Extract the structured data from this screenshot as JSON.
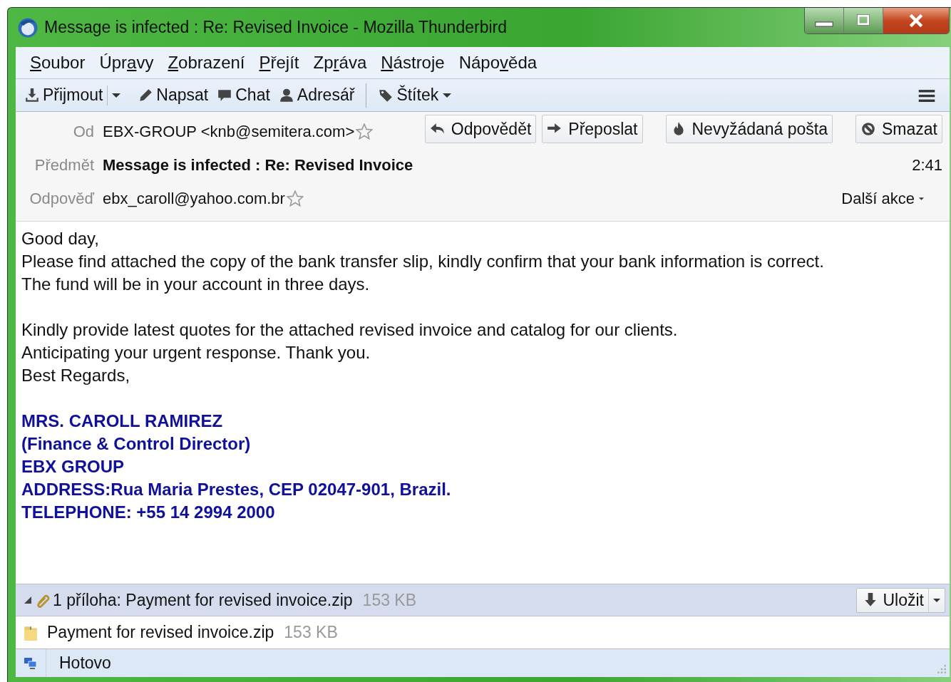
{
  "window": {
    "title": "Message is infected : Re: Revised Invoice - Mozilla Thunderbird"
  },
  "menu": [
    {
      "key": "S",
      "after": "oubor"
    },
    {
      "before": "Úpr",
      "key": "a",
      "after": "vy"
    },
    {
      "key": "Z",
      "after": "obrazení"
    },
    {
      "key": "P",
      "after": "řejít"
    },
    {
      "before": "Zp",
      "key": "r",
      "after": "áva"
    },
    {
      "key": "N",
      "after": "ástroje"
    },
    {
      "before": "Nápo",
      "key": "v",
      "after": "ěda"
    }
  ],
  "toolbar": [
    {
      "label": "Přijmout",
      "kind": "split"
    },
    {
      "label": "Napsat",
      "kind": "plain"
    },
    {
      "label": "Chat",
      "kind": "plain"
    },
    {
      "label": "Adresář",
      "kind": "plain"
    },
    {
      "label": "Štítek",
      "kind": "menu"
    }
  ],
  "header": {
    "buttons": [
      "Odpovědět",
      "Přeposlat",
      "Nevyžádaná pošta",
      "Smazat"
    ],
    "from": {
      "label": "Od",
      "value": "EBX-GROUP <knb@semitera.com>"
    },
    "subject": {
      "label": "Předmět",
      "value": "Message is infected : Re: Revised Invoice"
    },
    "time": "2:41",
    "reply_to": {
      "label": "Odpověď",
      "value": "ebx_caroll@yahoo.com.br"
    },
    "more_actions": "Další akce"
  },
  "body": [
    {
      "kind": "text",
      "lines": [
        "Good day,",
        "Please find attached the copy of the bank transfer slip, kindly confirm that your bank information is correct.",
        "The fund will be in your account in three days."
      ]
    },
    {
      "kind": "text",
      "lines": [
        "Kindly provide latest quotes for the attached revised invoice and catalog for our clients.",
        "Anticipating your urgent response. Thank you.",
        "Best Regards,"
      ]
    },
    {
      "kind": "signature",
      "lines": [
        "MRS. CAROLL RAMIREZ",
        "(Finance & Control Director)",
        "EBX GROUP",
        "ADDRESS:Rua Maria Prestes, CEP 02047-901, Brazil.",
        "TELEPHONE: +55 14 2994 2000"
      ]
    }
  ],
  "attachment_bar": {
    "expanded": true,
    "summary": "1 příloha: Payment for revised invoice.zip",
    "size": "153 KB",
    "save": "Uložit"
  },
  "attachments": [
    {
      "name": "Payment for revised invoice.zip",
      "size": "153 KB"
    }
  ],
  "status_bar": {
    "text": "Hotovo"
  }
}
